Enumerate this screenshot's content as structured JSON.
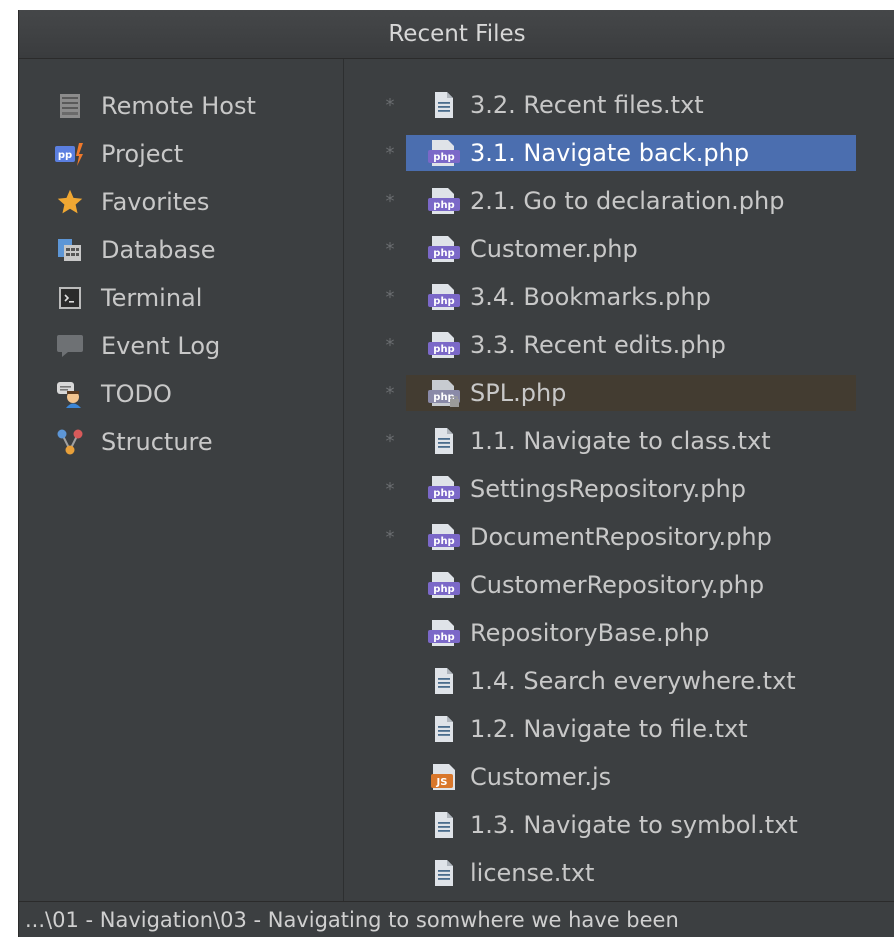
{
  "popup": {
    "title": "Recent Files"
  },
  "tool_windows": [
    {
      "label": "Remote Host",
      "icon": "server-icon"
    },
    {
      "label": "Project",
      "icon": "project-icon"
    },
    {
      "label": "Favorites",
      "icon": "star-icon"
    },
    {
      "label": "Database",
      "icon": "database-icon"
    },
    {
      "label": "Terminal",
      "icon": "terminal-icon"
    },
    {
      "label": "Event Log",
      "icon": "speech-bubble-icon"
    },
    {
      "label": "TODO",
      "icon": "todo-icon"
    },
    {
      "label": "Structure",
      "icon": "structure-icon"
    }
  ],
  "files": [
    {
      "name": "3.2. Recent files.txt",
      "type": "txt",
      "marked": true
    },
    {
      "name": "3.1. Navigate back.php",
      "type": "php",
      "marked": true,
      "selected": true
    },
    {
      "name": "2.1. Go to declaration.php",
      "type": "php",
      "marked": true
    },
    {
      "name": "Customer.php",
      "type": "php",
      "marked": true
    },
    {
      "name": "3.4. Bookmarks.php",
      "type": "php",
      "marked": true
    },
    {
      "name": "3.3. Recent edits.php",
      "type": "php",
      "marked": true
    },
    {
      "name": "SPL.php",
      "type": "php-lib",
      "marked": true,
      "current": true
    },
    {
      "name": "1.1. Navigate to class.txt",
      "type": "txt",
      "marked": true
    },
    {
      "name": "SettingsRepository.php",
      "type": "php",
      "marked": true
    },
    {
      "name": "DocumentRepository.php",
      "type": "php",
      "marked": true
    },
    {
      "name": "CustomerRepository.php",
      "type": "php",
      "marked": false
    },
    {
      "name": "RepositoryBase.php",
      "type": "php",
      "marked": false
    },
    {
      "name": "1.4. Search everywhere.txt",
      "type": "txt",
      "marked": false
    },
    {
      "name": "1.2. Navigate to file.txt",
      "type": "txt",
      "marked": false
    },
    {
      "name": "Customer.js",
      "type": "js",
      "marked": false
    },
    {
      "name": "1.3. Navigate to symbol.txt",
      "type": "txt",
      "marked": false
    },
    {
      "name": "license.txt",
      "type": "txt",
      "marked": false
    }
  ],
  "marker_glyph": "*",
  "php_icon_text": "php",
  "js_icon_text": "JS",
  "project_icon_text": "pp",
  "status": {
    "path": "...\\01 - Navigation\\03 - Navigating to somwhere we have been"
  },
  "colors": {
    "selection": "#4b6eaf",
    "current_row": "#433c31",
    "php_icon": "#7b68c8",
    "js_icon": "#d9772b"
  }
}
